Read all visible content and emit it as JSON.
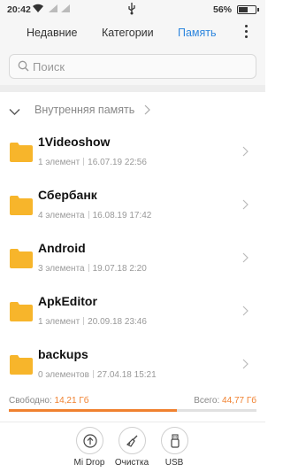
{
  "status": {
    "time": "20:42",
    "battery": "56%",
    "battery_level": 0.56
  },
  "tabs": [
    {
      "label": "Недавние",
      "active": false
    },
    {
      "label": "Категории",
      "active": false
    },
    {
      "label": "Память",
      "active": true
    }
  ],
  "search": {
    "placeholder": "Поиск"
  },
  "breadcrumb": {
    "label": "Внутренняя память"
  },
  "folders": [
    {
      "name": "1Videoshow",
      "count": "1 элемент",
      "date": "16.07.19 22:56"
    },
    {
      "name": "Сбербанк",
      "count": "4 элемента",
      "date": "16.08.19 17:42"
    },
    {
      "name": "Android",
      "count": "3 элемента",
      "date": "19.07.18 2:20"
    },
    {
      "name": "ApkEditor",
      "count": "1 элемент",
      "date": "20.09.18 23:46"
    },
    {
      "name": "backups",
      "count": "0 элементов",
      "date": "27.04.18 15:21"
    }
  ],
  "storage": {
    "free_label": "Свободно:",
    "free_value": "14,21 Гб",
    "total_label": "Всего:",
    "total_value": "44,77 Гб",
    "used_fraction": 0.68
  },
  "bottom_bar": {
    "mi_drop": "Mi Drop",
    "cleanup": "Очистка",
    "usb": "USB"
  },
  "colors": {
    "accent": "#2e86de",
    "folder": "#f7b52b",
    "storage": "#f0812f"
  }
}
